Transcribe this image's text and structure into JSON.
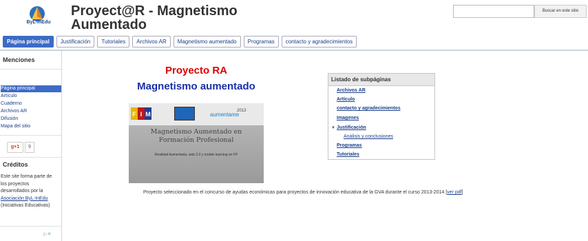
{
  "header": {
    "logo_text": "ByL-InEdu",
    "title": "Proyect@R - Magnetismo Aumentado",
    "search_placeholder": "",
    "search_button": "Buscar en este sitio"
  },
  "nav": {
    "tabs": [
      {
        "label": "Página principal",
        "active": true
      },
      {
        "label": "Justificación",
        "active": false
      },
      {
        "label": "Tutoriales",
        "active": false
      },
      {
        "label": "Archivos AR",
        "active": false
      },
      {
        "label": "Magnetismo aumentado",
        "active": false
      },
      {
        "label": "Programas",
        "active": false
      },
      {
        "label": "contacto y agradecimientos",
        "active": false
      }
    ]
  },
  "sidebar": {
    "menciones_heading": "Menciones",
    "items": [
      {
        "label": "Página principal",
        "active": true
      },
      {
        "label": "Artículo",
        "active": false
      },
      {
        "label": "Cuaderno",
        "active": false
      },
      {
        "label": "Archivos AR",
        "active": false
      },
      {
        "label": "Difusión",
        "active": false
      },
      {
        "label": "Mapa del sitio",
        "active": false
      }
    ],
    "gplus_label": "g+1",
    "gplus_count": "9",
    "credits_heading": "Créditos",
    "credits_text_1": "Este site forma parte de los proyectos desarrollados por la",
    "credits_link": "Asociación ByL-InEdu",
    "credits_text_2": "(Iniciativas Educativas)",
    "ad_badge": "▷✕"
  },
  "main": {
    "title": "Proyecto RA",
    "subtitle": "Magnetismo aumentado",
    "banner": {
      "fim_letters": [
        "F",
        "I",
        "M"
      ],
      "aumenta_text": "aumentame",
      "year_text": "2013",
      "title_line1": "Magnetismo Aumentado en",
      "title_line2": "Formación Profesional",
      "tagline": "Realidad Aumentada, web 2.0 y mobile learning en FP"
    },
    "caption_text": "Proyecto seleccionado en el concurso de ayudas económicas para proyectos de innovación educativa de la GVA durante el curso 2013-2014 [",
    "caption_link": "ver pdf",
    "caption_end": "]"
  },
  "subpages": {
    "heading": "Listado de subpáginas",
    "items": [
      {
        "label": "Archivos AR",
        "child": false
      },
      {
        "label": "Artículo",
        "child": false
      },
      {
        "label": "contacto y agradecimientos",
        "child": false
      },
      {
        "label": "Imagenes",
        "child": false
      },
      {
        "label": "Justificación",
        "child": false
      },
      {
        "label": "Análisis y conclusiones",
        "child": true
      },
      {
        "label": "Programas",
        "child": false
      },
      {
        "label": "Tutoriales",
        "child": false
      }
    ]
  },
  "colors": {
    "accent": "#3d6bc5",
    "title_red": "#dd0000",
    "title_blue": "#1a2fa8",
    "link": "#1a3f8a"
  }
}
